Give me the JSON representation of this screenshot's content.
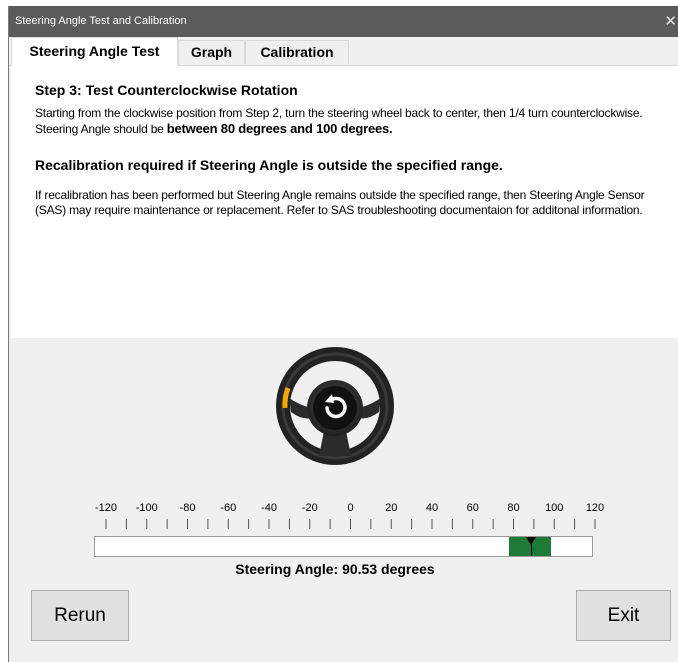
{
  "window": {
    "title": "Steering Angle Test and Calibration",
    "close_glyph": "✕"
  },
  "tabs": [
    {
      "label": "Steering Angle Test"
    },
    {
      "label": "Graph"
    },
    {
      "label": "Calibration"
    }
  ],
  "instructions": {
    "step_title": "Step 3: Test Counterclockwise Rotation",
    "paragraph1_text": "Starting from the clockwise position from Step 2, turn the steering wheel back to center, then 1/4 turn counterclockwise. Steering Angle should be ",
    "paragraph1_bold": "between 80 degrees and 100 degrees.",
    "recalibration_warning": "Recalibration required if Steering Angle is outside the specified range.",
    "paragraph2": "If recalibration has been performed but Steering Angle remains outside the specified range, then Steering Angle Sensor (SAS) may require maintenance or replacement. Refer to SAS troubleshooting documentaion for additonal information."
  },
  "gauge": {
    "tick_labels": [
      "-120",
      "-100",
      "-80",
      "-60",
      "-40",
      "-20",
      "0",
      "20",
      "40",
      "60",
      "80",
      "100",
      "120"
    ],
    "min": -120,
    "max": 120,
    "pass_range": [
      80,
      100
    ],
    "current_angle": 90.53,
    "pass_color": "#1e7b37"
  },
  "status": {
    "steering_angle_text": "Steering Angle: 90.53 degrees"
  },
  "buttons": {
    "rerun": "Rerun",
    "exit": "Exit"
  },
  "icons": {
    "wheel": "steering-wheel-rotate-icon"
  }
}
